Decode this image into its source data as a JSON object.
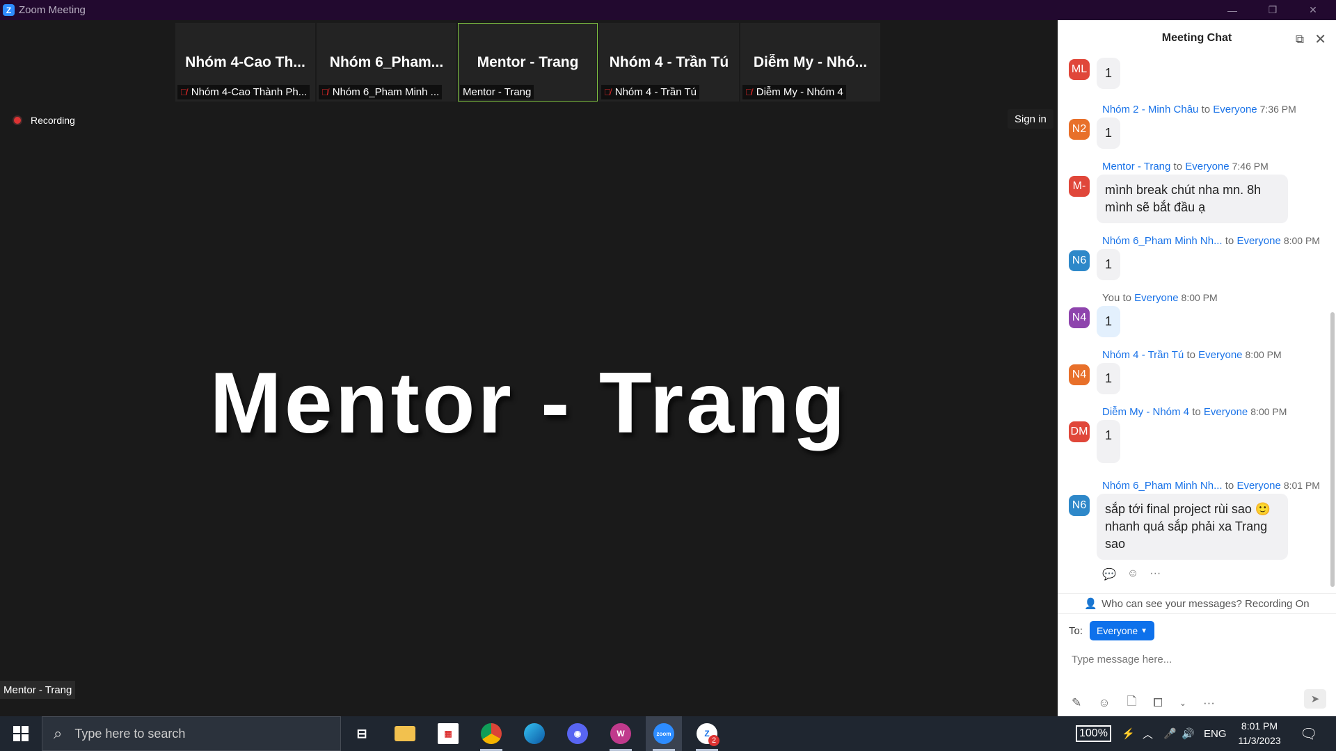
{
  "window": {
    "title": "Zoom Meeting",
    "minimize": "—",
    "restore": "❐",
    "close": "✕"
  },
  "thumbnails": [
    {
      "big": "Nhóm 4-Cao Th...",
      "name": "Nhóm 4-Cao Thành Ph...",
      "muted": true,
      "active": false
    },
    {
      "big": "Nhóm  6_Pham...",
      "name": "Nhóm 6_Pham Minh ...",
      "muted": true,
      "active": false
    },
    {
      "big": "Mentor - Trang",
      "name": "Mentor - Trang",
      "muted": false,
      "active": true
    },
    {
      "big": "Nhóm 4 - Trần Tú",
      "name": "Nhóm 4 - Trần Tú",
      "muted": true,
      "active": false
    },
    {
      "big": "Diễm My - Nhó...",
      "name": "Diễm My - Nhóm 4",
      "muted": true,
      "active": false
    }
  ],
  "recording_label": "Recording",
  "sign_in_label": "Sign in",
  "main_speaker": "Mentor - Trang",
  "bottom_name": "Mentor - Trang",
  "chat": {
    "title": "Meeting Chat",
    "messages": [
      {
        "avatar": "ML",
        "color": "#e0473a",
        "sender": "",
        "to_word": "",
        "recipient": "",
        "time": "",
        "text": "1",
        "me": false
      },
      {
        "avatar": "N2",
        "color": "#e8702a",
        "sender": "Nhóm 2 - Minh Châu",
        "to_word": "to",
        "recipient": "Everyone",
        "time": "7:36 PM",
        "text": "1",
        "me": false
      },
      {
        "avatar": "M-",
        "color": "#e0473a",
        "sender": "Mentor - Trang",
        "to_word": "to",
        "recipient": "Everyone",
        "time": "7:46 PM",
        "text": "mình break chút nha mn. 8h mình sẽ bắt đầu ạ",
        "me": false
      },
      {
        "avatar": "N6",
        "color": "#2e88c9",
        "sender": "Nhóm 6_Pham Minh Nh...",
        "to_word": "to",
        "recipient": "Everyone",
        "time": "8:00 PM",
        "text": "1",
        "me": false
      },
      {
        "avatar": "N4",
        "color": "#8e44ad",
        "sender": "You",
        "to_word": "to",
        "recipient": "Everyone",
        "time": "8:00 PM",
        "text": "1",
        "me": true
      },
      {
        "avatar": "N4",
        "color": "#e8702a",
        "sender": "Nhóm 4 - Trần Tú",
        "to_word": "to",
        "recipient": "Everyone",
        "time": "8:00 PM",
        "text": "1",
        "me": false
      },
      {
        "avatar": "DM",
        "color": "#e0473a",
        "sender": "Diễm My - Nhóm 4",
        "to_word": "to",
        "recipient": "Everyone",
        "time": "8:00 PM",
        "text": "1",
        "me": false
      },
      {
        "avatar": "N6",
        "color": "#2e88c9",
        "sender": "Nhóm 6_Pham Minh Nh...",
        "to_word": "to",
        "recipient": "Everyone",
        "time": "8:01 PM",
        "text": "sắp tới final project rùi sao 🙂 nhanh quá sắp phải xa Trang sao",
        "me": false
      }
    ],
    "who_can_see": "Who can see your messages? Recording On",
    "to_label": "To:",
    "to_value": "Everyone",
    "placeholder": "Type message here..."
  },
  "taskbar": {
    "search_placeholder": "Type here to search",
    "battery": "100%",
    "lang": "ENG",
    "time": "8:01 PM",
    "date": "11/3/2023",
    "zoom_badge": "2"
  }
}
